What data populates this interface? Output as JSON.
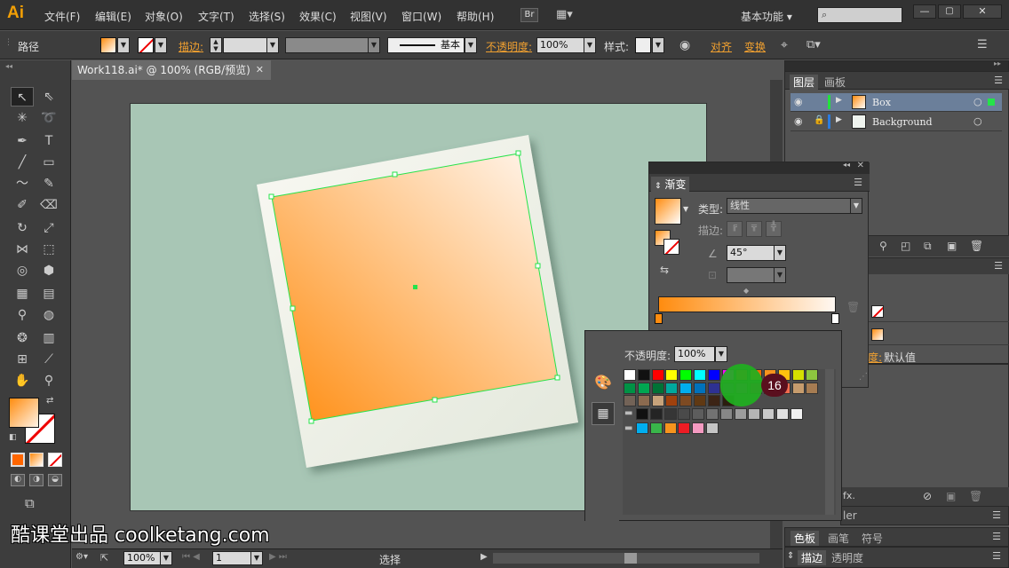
{
  "app": {
    "logo": "Ai",
    "workspace": "基本功能"
  },
  "menu": [
    "文件(F)",
    "编辑(E)",
    "对象(O)",
    "文字(T)",
    "选择(S)",
    "效果(C)",
    "视图(V)",
    "窗口(W)",
    "帮助(H)"
  ],
  "menubar_buttons": {
    "bridge": "Br"
  },
  "control_bar": {
    "selection_label": "路径",
    "stroke_label": "描边:",
    "brush_label": "基本",
    "opacity_label": "不透明度:",
    "opacity_value": "100%",
    "style_label": "样式:",
    "align_label": "对齐",
    "transform_label": "变换"
  },
  "document": {
    "tab_title": "Work118.ai* @ 100% (RGB/预览)"
  },
  "status": {
    "zoom": "100%",
    "page": "1",
    "tool": "选择"
  },
  "layers_panel": {
    "tabs": [
      "图层",
      "画板"
    ],
    "rows": [
      {
        "name": "Box",
        "color": "#23e23c"
      },
      {
        "name": "Background",
        "color": "#2b7be0"
      }
    ]
  },
  "gradient_panel": {
    "title": "渐变",
    "type_label": "类型:",
    "type_value": "线性",
    "stroke_label": "描边:",
    "angle_value": "45°"
  },
  "swatch_popup": {
    "opacity_label": "不透明度:",
    "opacity_value": "100%",
    "badge": "16"
  },
  "appearance_panel": {
    "default_label": "默认值",
    "default_prefix": "度:"
  },
  "brush_panel_partial": {
    "label": "ler"
  },
  "bottom_tabs": {
    "row1": [
      "色板",
      "画笔",
      "符号"
    ],
    "row2": [
      "描边",
      "透明度"
    ]
  },
  "watermark": "酷课堂出品 coolketang.com",
  "colors": {
    "accent": "#f29f05",
    "gradient_start": "#ff8c0f",
    "gradient_end": "#fff8f2",
    "selection": "#25e34a"
  }
}
